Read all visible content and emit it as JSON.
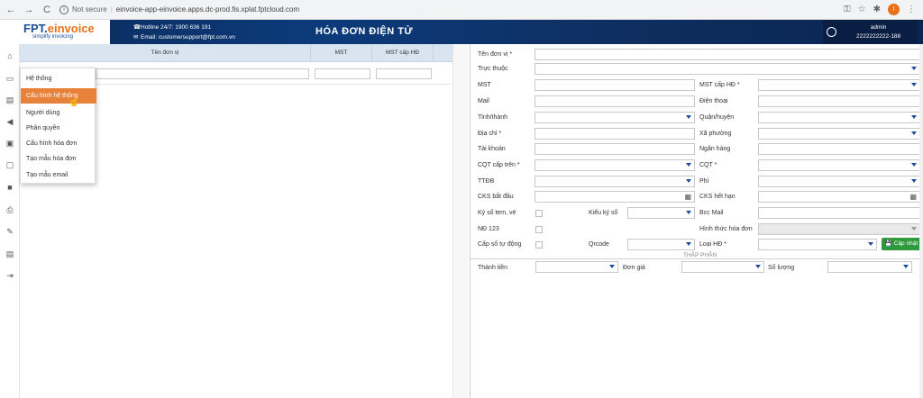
{
  "browser": {
    "back": "←",
    "forward": "→",
    "reload": "C",
    "info_icon": "i",
    "not_secure": "Not secure",
    "sep": "|",
    "url": "einvoice-app-einvoice.apps.dc-prod.fis.xplat.fptcloud.com",
    "key_icon": "⚿",
    "star_icon": "☆",
    "ext_icon": "✱",
    "profile_letter": "I",
    "menu_icon": "⋮"
  },
  "header": {
    "logo_prefix": "FPT.",
    "logo_suffix": "einvoice",
    "logo_tag": "simplify invoicing",
    "hotline_icon": "☎",
    "hotline": "Hotline 24/7: 1900 636 191",
    "email_icon": "✉",
    "email": "Email: customersupport@fpt.com.vn",
    "title": "HÓA ĐƠN ĐIỆN TỬ",
    "user_name": "admin",
    "user_id": "2222222222-188"
  },
  "sidebar": {
    "icons": [
      "⌂",
      "▭",
      "▤",
      "◀",
      "▣",
      "▢",
      "■",
      "⎙",
      "✎",
      "▤",
      "⇥"
    ]
  },
  "grid": {
    "columns": [
      "Tên đơn vị",
      "MST",
      "MST cấp HĐ"
    ]
  },
  "menu": {
    "items": [
      "Hệ thống",
      "Cấu hình hệ thống",
      "Người dùng",
      "Phân quyền",
      "Cấu hình hóa đơn",
      "Tạo mẫu hóa đơn",
      "Tạo mẫu email"
    ]
  },
  "cursor": "☝",
  "form": {
    "ten_don_vi": "Tên đơn vị *",
    "truc_thuoc": "Trực thuộc",
    "mst": "MST",
    "mst_cap_hd": "MST cấp HĐ *",
    "mail": "Mail",
    "dien_thoai": "Điện thoại",
    "tinh_thanh": "Tỉnh/thành",
    "quan_huyen": "Quận/huyện",
    "dia_chi": "Địa chỉ *",
    "xa_phuong": "Xã phường",
    "tai_khoan": "Tài khoản",
    "ngan_hang": "Ngân hàng",
    "cqt_cap_tren": "CQT cấp trên *",
    "cqt": "CQT *",
    "ttdb": "TTĐB",
    "phi": "Phí",
    "cks_bat_dau": "CKS bắt đầu",
    "cks_het_han": "CKS hết hạn",
    "ky_so_tem_ve": "Ký số tem, vé",
    "kieu_ky_so": "Kiểu ký số",
    "bcc_mail": "Bcc Mail",
    "nd_123": "NĐ 123",
    "hinh_thuc_hoa_don": "Hình thức hóa đơn",
    "cap_so_tu_dong": "Cấp số tự động",
    "qrcode": "Qrcode",
    "loai_hd": "Loại HĐ *",
    "cap_nhat": "Cập nhật",
    "save_icon": "💾",
    "calendar_icon": "▦",
    "section_thap_phan": "THẬP PHÂN",
    "thanh_tien": "Thành tiền",
    "don_gia": "Đơn giá",
    "so_luong": "Số lượng"
  }
}
